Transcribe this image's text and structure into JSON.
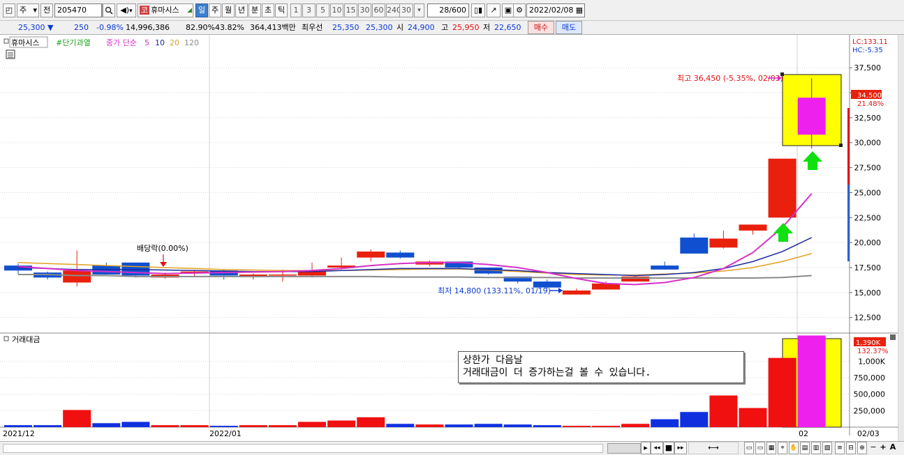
{
  "toolbar": {
    "period_type": "주",
    "prev_label": "전",
    "stock_code": "205470",
    "market_badge": "코",
    "stock_name": "휴마시스",
    "intervals": [
      "일",
      "주",
      "월",
      "년",
      "분",
      "초",
      "틱"
    ],
    "active_interval": "일",
    "minute_steps": [
      "1",
      "3",
      "5",
      "10",
      "15",
      "30",
      "60",
      "240"
    ],
    "period_count": "30",
    "view_range": "28",
    "view_total": "/600",
    "date": "2022/02/08"
  },
  "quote": {
    "price": "25,300",
    "change_arrow": "▼",
    "change": "250",
    "change_pct": "-0.98%",
    "volume": "14,996,386",
    "ratio1": "82.90%",
    "ratio2": "43.82%",
    "amount": "364,413백만",
    "best_ask_label": "최우선",
    "best_ask": "25,350",
    "best_bid": "25,300",
    "open_label": "시",
    "open": "24,900",
    "high_label": "고",
    "high": "25,950",
    "low_label": "저",
    "low": "22,650",
    "buy_label": "매수",
    "sell_label": "매도"
  },
  "legend": {
    "name": "휴마시스",
    "tag": "#단기과열",
    "ma_label": "종가 단순",
    "ma5": "5",
    "ma10": "10",
    "ma20": "20",
    "ma120": "120",
    "colors": {
      "ma5": "#d62fc8",
      "ma10": "#1a2aa0",
      "ma20": "#e0a020",
      "ma120": "#8a8a8a",
      "up": "#e8200c",
      "down": "#1050d0"
    }
  },
  "price_axis": {
    "ticks": [
      "37,500",
      "35,000",
      "32,500",
      "30,000",
      "27,500",
      "25,000",
      "22,500",
      "20,000",
      "17,500",
      "15,000",
      "12,500"
    ],
    "lc": "LC:133.11",
    "hc": "HC:-5.35",
    "current_price": "34,500",
    "current_pct": "21.48%"
  },
  "annotations": {
    "high": "최고 36,450 (-5.35%, 02/03)",
    "low": "최저 14,800 (133.11%, 01/19)",
    "dividend": "배당락(0.00%)"
  },
  "volume_panel": {
    "title": "거래대금",
    "ticks": [
      "1,000K",
      "750,000",
      "500,000",
      "250,000"
    ],
    "current_value": "1,390K",
    "current_pct": "132.37%"
  },
  "note": {
    "line1": "상한가 다음날",
    "line2": "거래대금이 더 증가하는걸 볼 수 있습니다."
  },
  "date_axis": {
    "labels": [
      "2021/12",
      "2022/01",
      "02",
      "02/03"
    ]
  },
  "bottom": {
    "zoom_minus": "−",
    "zoom_plus": "+",
    "font_btn": "A"
  },
  "chart_data": {
    "type": "candlestick",
    "candles": [
      {
        "o": 17700,
        "h": 17900,
        "l": 16800,
        "c": 17200
      },
      {
        "o": 17000,
        "h": 17100,
        "l": 16300,
        "c": 16500
      },
      {
        "o": 16000,
        "h": 19200,
        "l": 15600,
        "c": 17200
      },
      {
        "o": 17700,
        "h": 18000,
        "l": 16800,
        "c": 16800
      },
      {
        "o": 18000,
        "h": 18000,
        "l": 16500,
        "c": 16700
      },
      {
        "o": 16500,
        "h": 17000,
        "l": 16400,
        "c": 16800
      },
      {
        "o": 17000,
        "h": 17200,
        "l": 16600,
        "c": 17100
      },
      {
        "o": 17200,
        "h": 17300,
        "l": 16300,
        "c": 16700
      },
      {
        "o": 16600,
        "h": 16900,
        "l": 16300,
        "c": 16800
      },
      {
        "o": 16700,
        "h": 17300,
        "l": 16100,
        "c": 16800
      },
      {
        "o": 16700,
        "h": 18000,
        "l": 16500,
        "c": 17200
      },
      {
        "o": 17500,
        "h": 18500,
        "l": 17300,
        "c": 17700
      },
      {
        "o": 18500,
        "h": 19300,
        "l": 18100,
        "c": 19100
      },
      {
        "o": 19000,
        "h": 19200,
        "l": 18400,
        "c": 18500
      },
      {
        "o": 17800,
        "h": 18200,
        "l": 17600,
        "c": 18100
      },
      {
        "o": 18100,
        "h": 18100,
        "l": 17400,
        "c": 17500
      },
      {
        "o": 17500,
        "h": 17500,
        "l": 16800,
        "c": 16900
      },
      {
        "o": 16600,
        "h": 16600,
        "l": 15900,
        "c": 16100
      },
      {
        "o": 16100,
        "h": 16300,
        "l": 15400,
        "c": 15500
      },
      {
        "o": 14800,
        "h": 15400,
        "l": 14800,
        "c": 15200
      },
      {
        "o": 15300,
        "h": 16100,
        "l": 15300,
        "c": 15900
      },
      {
        "o": 16100,
        "h": 16800,
        "l": 16100,
        "c": 16600
      },
      {
        "o": 17700,
        "h": 18100,
        "l": 17300,
        "c": 17300
      },
      {
        "o": 20500,
        "h": 20900,
        "l": 18900,
        "c": 18900
      },
      {
        "o": 19500,
        "h": 21200,
        "l": 19400,
        "c": 20400
      },
      {
        "o": 21200,
        "h": 21800,
        "l": 20800,
        "c": 21800
      },
      {
        "o": 22500,
        "h": 28400,
        "l": 22500,
        "c": 28400
      },
      {
        "o": 30800,
        "h": 36450,
        "l": 29400,
        "c": 34500
      }
    ],
    "ma5": [
      17600,
      17400,
      17200,
      17100,
      17000,
      16900,
      16950,
      17000,
      17050,
      17100,
      17200,
      17400,
      17700,
      17900,
      18000,
      18000,
      17800,
      17500,
      17000,
      16400,
      15900,
      15800,
      16000,
      16500,
      17400,
      19000,
      21500,
      24900
    ],
    "ma10": [
      17500,
      17400,
      17300,
      17300,
      17300,
      17250,
      17200,
      17150,
      17100,
      17100,
      17100,
      17200,
      17300,
      17400,
      17400,
      17400,
      17300,
      17200,
      17000,
      16900,
      16800,
      16700,
      16800,
      17000,
      17400,
      18100,
      19100,
      20500
    ],
    "ma20": [
      18000,
      17900,
      17800,
      17700,
      17600,
      17500,
      17400,
      17300,
      17250,
      17200,
      17200,
      17200,
      17250,
      17300,
      17350,
      17350,
      17250,
      17100,
      16950,
      16800,
      16750,
      16750,
      16850,
      16950,
      17150,
      17500,
      18100,
      18900
    ],
    "ma120": [
      16800,
      16800,
      16700,
      16700,
      16600,
      16600,
      16600,
      16600,
      16600,
      16600,
      16600,
      16600,
      16600,
      16550,
      16550,
      16550,
      16500,
      16500,
      16500,
      16450,
      16450,
      16450,
      16450,
      16450,
      16450,
      16450,
      16500,
      16700
    ],
    "trade_amount": [
      30000,
      30000,
      260000,
      60000,
      80000,
      30000,
      30000,
      20000,
      30000,
      30000,
      80000,
      100000,
      150000,
      50000,
      40000,
      40000,
      50000,
      40000,
      30000,
      20000,
      20000,
      50000,
      120000,
      230000,
      480000,
      290000,
      1050000,
      1390000
    ],
    "price_ylim": [
      11500,
      38700
    ],
    "amount_ylim": [
      0,
      1300000
    ]
  }
}
